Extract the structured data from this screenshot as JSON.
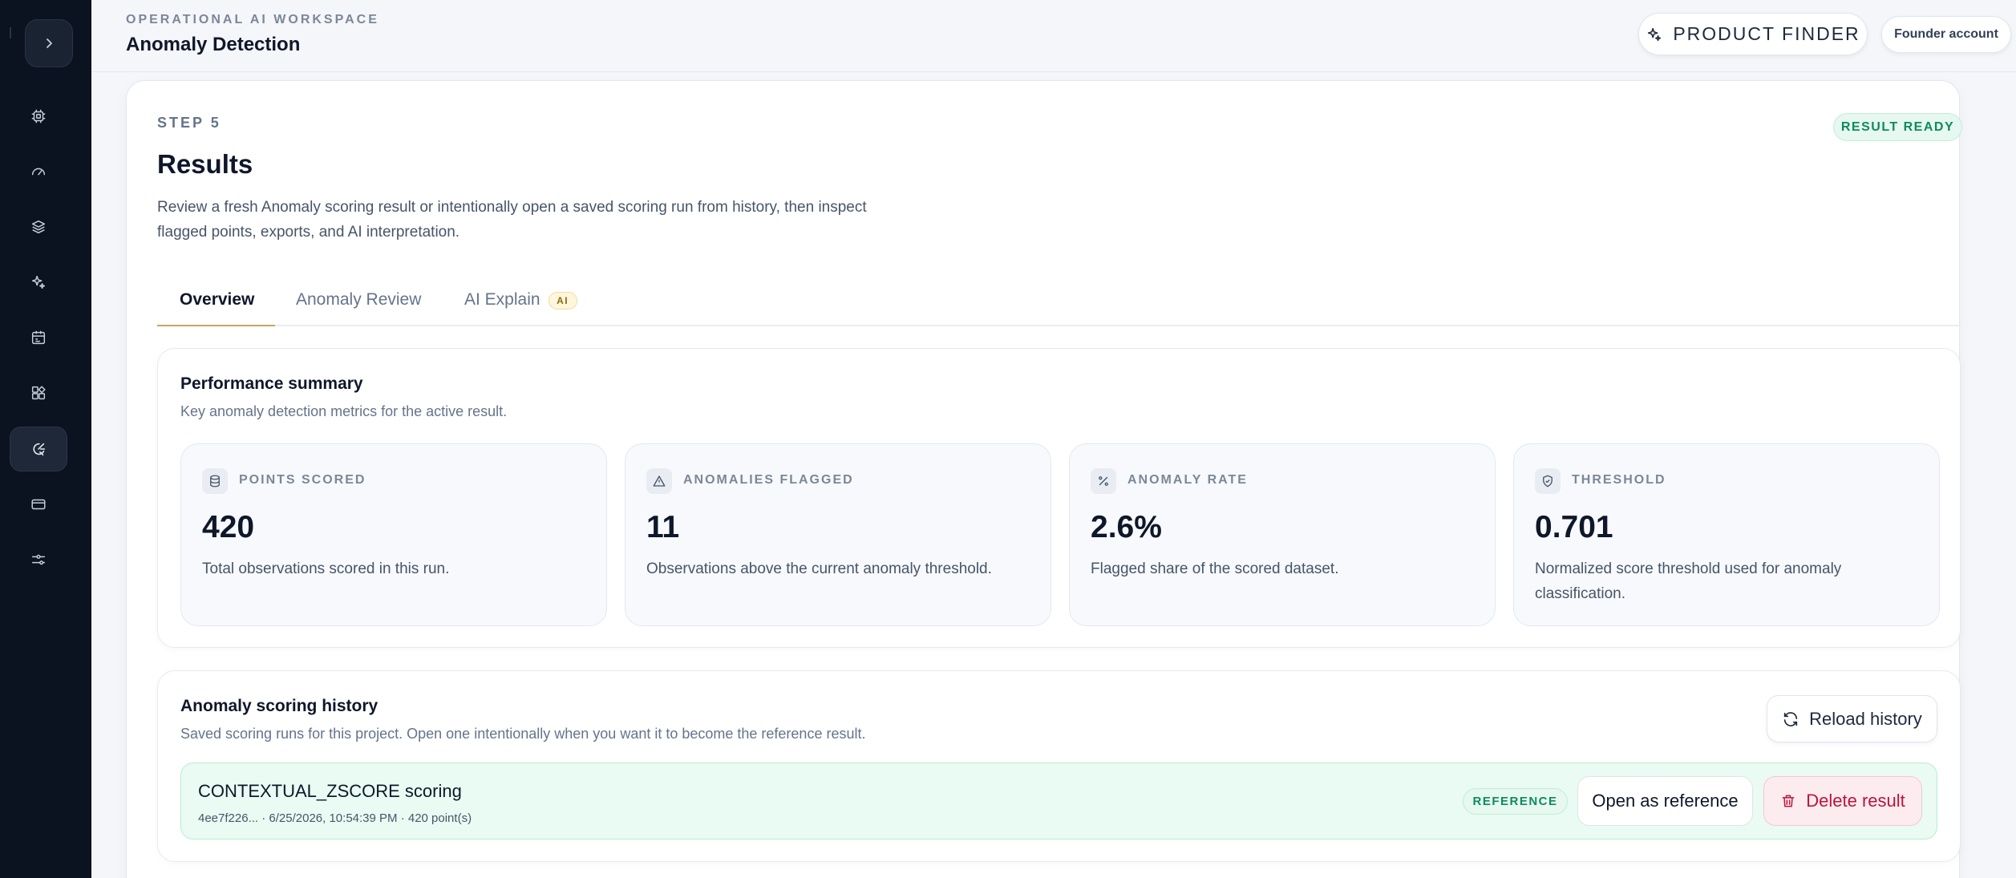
{
  "header": {
    "eyebrow": "OPERATIONAL AI WORKSPACE",
    "title": "Anomaly Detection",
    "product_finder_label": "PRODUCT FINDER",
    "account_label": "Founder account"
  },
  "sidebar": {
    "items": [
      {
        "icon": "cpu-icon"
      },
      {
        "icon": "gauge-icon"
      },
      {
        "icon": "layers-icon"
      },
      {
        "icon": "sparkles-icon"
      },
      {
        "icon": "calendar-icon"
      },
      {
        "icon": "widgets-icon"
      },
      {
        "icon": "anomaly-icon",
        "active": true
      },
      {
        "icon": "card-icon"
      },
      {
        "icon": "sliders-icon"
      }
    ]
  },
  "step": {
    "label": "STEP 5",
    "status_badge": "RESULT READY",
    "title": "Results",
    "description": "Review a fresh Anomaly scoring result or intentionally open a saved scoring run from history, then inspect flagged points, exports, and AI interpretation."
  },
  "tabs": [
    {
      "label": "Overview",
      "active": true
    },
    {
      "label": "Anomaly Review",
      "active": false
    },
    {
      "label": "AI Explain",
      "badge": "AI",
      "active": false
    }
  ],
  "summary": {
    "title": "Performance summary",
    "subtitle": "Key anomaly detection metrics for the active result.",
    "metrics": [
      {
        "label": "POINTS SCORED",
        "value": "420",
        "description": "Total observations scored in this run.",
        "icon": "database-icon"
      },
      {
        "label": "ANOMALIES FLAGGED",
        "value": "11",
        "description": "Observations above the current anomaly threshold.",
        "icon": "warning-icon"
      },
      {
        "label": "ANOMALY RATE",
        "value": "2.6%",
        "description": "Flagged share of the scored dataset.",
        "icon": "percent-icon"
      },
      {
        "label": "THRESHOLD",
        "value": "0.701",
        "description": "Normalized score threshold used for anomaly classification.",
        "icon": "shield-check-icon"
      }
    ]
  },
  "history": {
    "title": "Anomaly scoring history",
    "subtitle": "Saved scoring runs for this project. Open one intentionally when you want it to become the reference result.",
    "reload_label": "Reload history",
    "rows": [
      {
        "title": "CONTEXTUAL_ZSCORE scoring",
        "meta": "4ee7f226... · 6/25/2026, 10:54:39 PM · 420 point(s)",
        "badge": "REFERENCE",
        "open_label": "Open as reference",
        "delete_label": "Delete result"
      }
    ]
  },
  "colors": {
    "sidebar_bg": "#0b1220",
    "accent_gold": "#c9a45c",
    "success": "#0f8a5f",
    "danger": "#be123c"
  }
}
